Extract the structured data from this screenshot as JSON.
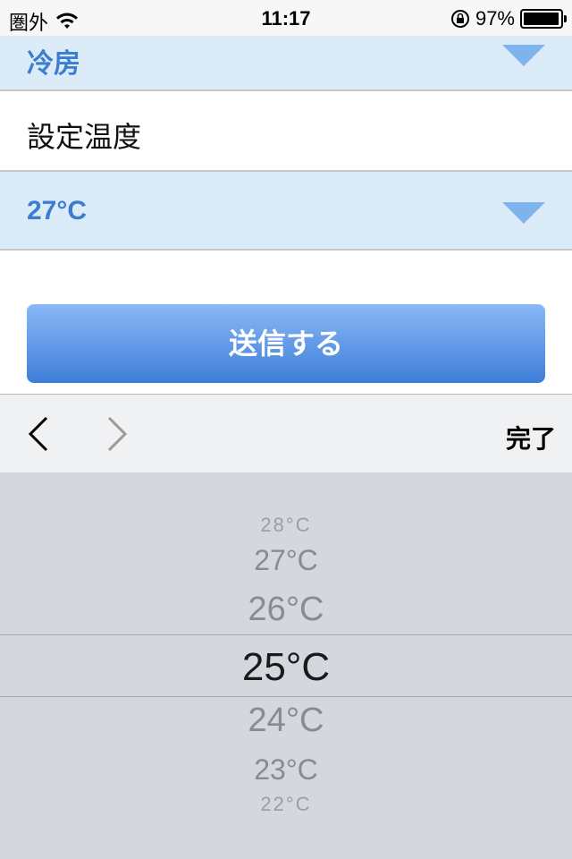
{
  "status_bar": {
    "carrier": "圏外",
    "time": "11:17",
    "battery_percent": "97%",
    "battery_level": 0.97
  },
  "form": {
    "mode_value": "冷房",
    "temperature_label": "設定温度",
    "temperature_value": "27°C",
    "send_label": "送信する"
  },
  "toolbar": {
    "done_label": "完了"
  },
  "picker": {
    "items": [
      "28°C",
      "27°C",
      "26°C",
      "25°C",
      "24°C",
      "23°C",
      "22°C"
    ],
    "selected": "25°C"
  },
  "colors": {
    "accent": "#3d7dd1",
    "select_bg": "#dcebf8",
    "picker_bg": "#d4d7dd"
  }
}
